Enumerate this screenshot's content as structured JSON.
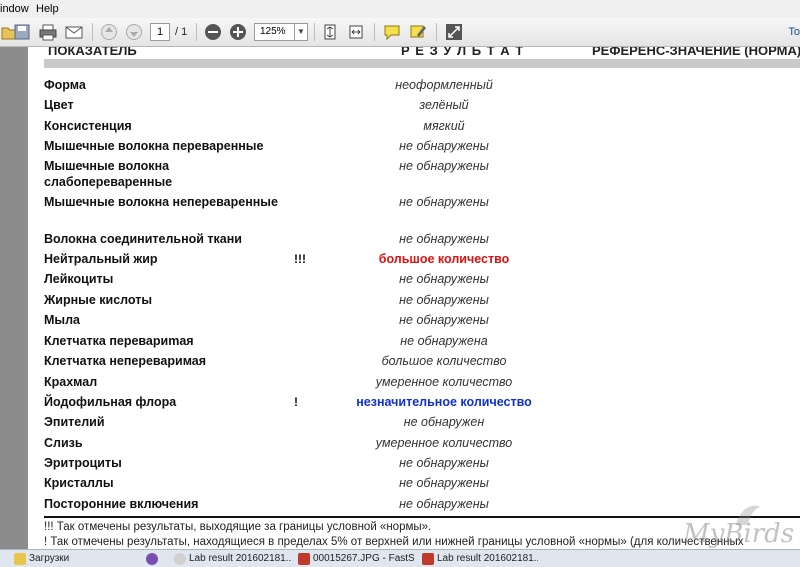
{
  "menu": {
    "window": "indow",
    "help": "Help"
  },
  "toolbar": {
    "page_current": "1",
    "page_total": "/ 1",
    "zoom": "125%",
    "tools_label": "To"
  },
  "report": {
    "col_param": "ПОКАЗАТЕЛЬ",
    "col_result": "Р Е З У Л Ь Т А Т",
    "col_ref": "РЕФЕРЕНС-ЗНАЧЕНИЕ (НОРМА)",
    "rows": [
      {
        "param": "Форма",
        "flag": "",
        "result": "неоформленный",
        "style": "normal"
      },
      {
        "param": "Цвет",
        "flag": "",
        "result": "зелёный",
        "style": "normal"
      },
      {
        "param": "Консистенция",
        "flag": "",
        "result": "мягкий",
        "style": "normal"
      },
      {
        "param": "Мышечные волокна переваренные",
        "flag": "",
        "result": "не обнаружены",
        "style": "normal"
      },
      {
        "param": "Мышечные волокна слабопереваренные",
        "flag": "",
        "result": "не обнаружены",
        "style": "normal"
      },
      {
        "param": "Мышечные волокна непереваренные",
        "flag": "",
        "result": "не обнаружены",
        "style": "normal"
      },
      {
        "param": "Волокна соединительной ткани",
        "flag": "",
        "result": "не обнаружены",
        "style": "normal"
      },
      {
        "param": "Нейтральный жир",
        "flag": "!!!",
        "result": "большое количество",
        "style": "red"
      },
      {
        "param": "Лейкоциты",
        "flag": "",
        "result": "не обнаружены",
        "style": "normal"
      },
      {
        "param": "Жирные кислоты",
        "flag": "",
        "result": "не обнаружены",
        "style": "normal"
      },
      {
        "param": "Мыла",
        "flag": "",
        "result": "не обнаружены",
        "style": "normal"
      },
      {
        "param": "Клетчатка перевариmая",
        "flag": "",
        "result": "не обнаружена",
        "style": "normal"
      },
      {
        "param": "Клетчатка непереваримая",
        "flag": "",
        "result": "большое количество",
        "style": "normal"
      },
      {
        "param": "Крахмал",
        "flag": "",
        "result": "умеренное количество",
        "style": "normal"
      },
      {
        "param": "Йодофильная флора",
        "flag": "!",
        "result": "незначительное количество",
        "style": "blue"
      },
      {
        "param": "Эпителий",
        "flag": "",
        "result": "не обнаружен",
        "style": "normal"
      },
      {
        "param": "Слизь",
        "flag": "",
        "result": "умеренное количество",
        "style": "normal"
      },
      {
        "param": "Эритроциты",
        "flag": "",
        "result": "не обнаружены",
        "style": "normal"
      },
      {
        "param": "Кристаллы",
        "flag": "",
        "result": "не обнаружены",
        "style": "normal"
      },
      {
        "param": "Посторонние включения",
        "flag": "",
        "result": "не обнаружены",
        "style": "normal"
      }
    ],
    "note1": "!!! Так отмечены результаты, выходящие за границы условной «нормы».",
    "note2": "!   Так отмечены результаты, находящиеся в пределах 5% от верхней или нижней границы условной «нормы» (для количественных"
  },
  "watermark": "MyBirds",
  "taskbar": [
    {
      "label": "Загрузки",
      "icon_color": "#e9c64a"
    },
    {
      "label": "",
      "icon_color": "#7a4fb0"
    },
    {
      "label": "Lab result 201602181...",
      "icon_color": "#d0d0d0"
    },
    {
      "label": "00015267.JPG - FastS...",
      "icon_color": "#c0392b"
    },
    {
      "label": "Lab result 201602181...",
      "icon_color": "#c0392b"
    }
  ],
  "colors": {
    "red_result": "#e01010",
    "blue_result": "#1030d0"
  }
}
